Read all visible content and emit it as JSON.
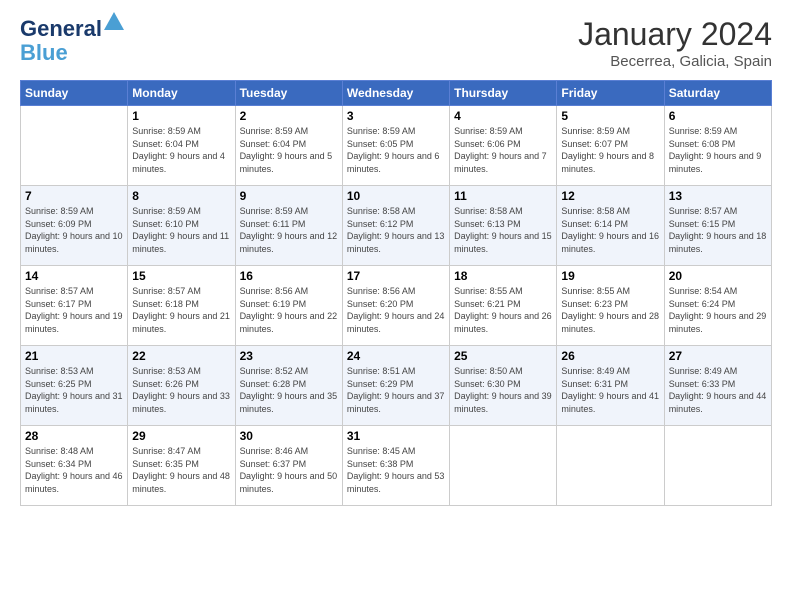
{
  "header": {
    "logo_line1": "General",
    "logo_line2": "Blue",
    "month": "January 2024",
    "location": "Becerrea, Galicia, Spain"
  },
  "days_of_week": [
    "Sunday",
    "Monday",
    "Tuesday",
    "Wednesday",
    "Thursday",
    "Friday",
    "Saturday"
  ],
  "weeks": [
    [
      {
        "day": "",
        "sunrise": "",
        "sunset": "",
        "daylight": ""
      },
      {
        "day": "1",
        "sunrise": "Sunrise: 8:59 AM",
        "sunset": "Sunset: 6:04 PM",
        "daylight": "Daylight: 9 hours and 4 minutes."
      },
      {
        "day": "2",
        "sunrise": "Sunrise: 8:59 AM",
        "sunset": "Sunset: 6:04 PM",
        "daylight": "Daylight: 9 hours and 5 minutes."
      },
      {
        "day": "3",
        "sunrise": "Sunrise: 8:59 AM",
        "sunset": "Sunset: 6:05 PM",
        "daylight": "Daylight: 9 hours and 6 minutes."
      },
      {
        "day": "4",
        "sunrise": "Sunrise: 8:59 AM",
        "sunset": "Sunset: 6:06 PM",
        "daylight": "Daylight: 9 hours and 7 minutes."
      },
      {
        "day": "5",
        "sunrise": "Sunrise: 8:59 AM",
        "sunset": "Sunset: 6:07 PM",
        "daylight": "Daylight: 9 hours and 8 minutes."
      },
      {
        "day": "6",
        "sunrise": "Sunrise: 8:59 AM",
        "sunset": "Sunset: 6:08 PM",
        "daylight": "Daylight: 9 hours and 9 minutes."
      }
    ],
    [
      {
        "day": "7",
        "sunrise": "Sunrise: 8:59 AM",
        "sunset": "Sunset: 6:09 PM",
        "daylight": "Daylight: 9 hours and 10 minutes."
      },
      {
        "day": "8",
        "sunrise": "Sunrise: 8:59 AM",
        "sunset": "Sunset: 6:10 PM",
        "daylight": "Daylight: 9 hours and 11 minutes."
      },
      {
        "day": "9",
        "sunrise": "Sunrise: 8:59 AM",
        "sunset": "Sunset: 6:11 PM",
        "daylight": "Daylight: 9 hours and 12 minutes."
      },
      {
        "day": "10",
        "sunrise": "Sunrise: 8:58 AM",
        "sunset": "Sunset: 6:12 PM",
        "daylight": "Daylight: 9 hours and 13 minutes."
      },
      {
        "day": "11",
        "sunrise": "Sunrise: 8:58 AM",
        "sunset": "Sunset: 6:13 PM",
        "daylight": "Daylight: 9 hours and 15 minutes."
      },
      {
        "day": "12",
        "sunrise": "Sunrise: 8:58 AM",
        "sunset": "Sunset: 6:14 PM",
        "daylight": "Daylight: 9 hours and 16 minutes."
      },
      {
        "day": "13",
        "sunrise": "Sunrise: 8:57 AM",
        "sunset": "Sunset: 6:15 PM",
        "daylight": "Daylight: 9 hours and 18 minutes."
      }
    ],
    [
      {
        "day": "14",
        "sunrise": "Sunrise: 8:57 AM",
        "sunset": "Sunset: 6:17 PM",
        "daylight": "Daylight: 9 hours and 19 minutes."
      },
      {
        "day": "15",
        "sunrise": "Sunrise: 8:57 AM",
        "sunset": "Sunset: 6:18 PM",
        "daylight": "Daylight: 9 hours and 21 minutes."
      },
      {
        "day": "16",
        "sunrise": "Sunrise: 8:56 AM",
        "sunset": "Sunset: 6:19 PM",
        "daylight": "Daylight: 9 hours and 22 minutes."
      },
      {
        "day": "17",
        "sunrise": "Sunrise: 8:56 AM",
        "sunset": "Sunset: 6:20 PM",
        "daylight": "Daylight: 9 hours and 24 minutes."
      },
      {
        "day": "18",
        "sunrise": "Sunrise: 8:55 AM",
        "sunset": "Sunset: 6:21 PM",
        "daylight": "Daylight: 9 hours and 26 minutes."
      },
      {
        "day": "19",
        "sunrise": "Sunrise: 8:55 AM",
        "sunset": "Sunset: 6:23 PM",
        "daylight": "Daylight: 9 hours and 28 minutes."
      },
      {
        "day": "20",
        "sunrise": "Sunrise: 8:54 AM",
        "sunset": "Sunset: 6:24 PM",
        "daylight": "Daylight: 9 hours and 29 minutes."
      }
    ],
    [
      {
        "day": "21",
        "sunrise": "Sunrise: 8:53 AM",
        "sunset": "Sunset: 6:25 PM",
        "daylight": "Daylight: 9 hours and 31 minutes."
      },
      {
        "day": "22",
        "sunrise": "Sunrise: 8:53 AM",
        "sunset": "Sunset: 6:26 PM",
        "daylight": "Daylight: 9 hours and 33 minutes."
      },
      {
        "day": "23",
        "sunrise": "Sunrise: 8:52 AM",
        "sunset": "Sunset: 6:28 PM",
        "daylight": "Daylight: 9 hours and 35 minutes."
      },
      {
        "day": "24",
        "sunrise": "Sunrise: 8:51 AM",
        "sunset": "Sunset: 6:29 PM",
        "daylight": "Daylight: 9 hours and 37 minutes."
      },
      {
        "day": "25",
        "sunrise": "Sunrise: 8:50 AM",
        "sunset": "Sunset: 6:30 PM",
        "daylight": "Daylight: 9 hours and 39 minutes."
      },
      {
        "day": "26",
        "sunrise": "Sunrise: 8:49 AM",
        "sunset": "Sunset: 6:31 PM",
        "daylight": "Daylight: 9 hours and 41 minutes."
      },
      {
        "day": "27",
        "sunrise": "Sunrise: 8:49 AM",
        "sunset": "Sunset: 6:33 PM",
        "daylight": "Daylight: 9 hours and 44 minutes."
      }
    ],
    [
      {
        "day": "28",
        "sunrise": "Sunrise: 8:48 AM",
        "sunset": "Sunset: 6:34 PM",
        "daylight": "Daylight: 9 hours and 46 minutes."
      },
      {
        "day": "29",
        "sunrise": "Sunrise: 8:47 AM",
        "sunset": "Sunset: 6:35 PM",
        "daylight": "Daylight: 9 hours and 48 minutes."
      },
      {
        "day": "30",
        "sunrise": "Sunrise: 8:46 AM",
        "sunset": "Sunset: 6:37 PM",
        "daylight": "Daylight: 9 hours and 50 minutes."
      },
      {
        "day": "31",
        "sunrise": "Sunrise: 8:45 AM",
        "sunset": "Sunset: 6:38 PM",
        "daylight": "Daylight: 9 hours and 53 minutes."
      },
      {
        "day": "",
        "sunrise": "",
        "sunset": "",
        "daylight": ""
      },
      {
        "day": "",
        "sunrise": "",
        "sunset": "",
        "daylight": ""
      },
      {
        "day": "",
        "sunrise": "",
        "sunset": "",
        "daylight": ""
      }
    ]
  ]
}
